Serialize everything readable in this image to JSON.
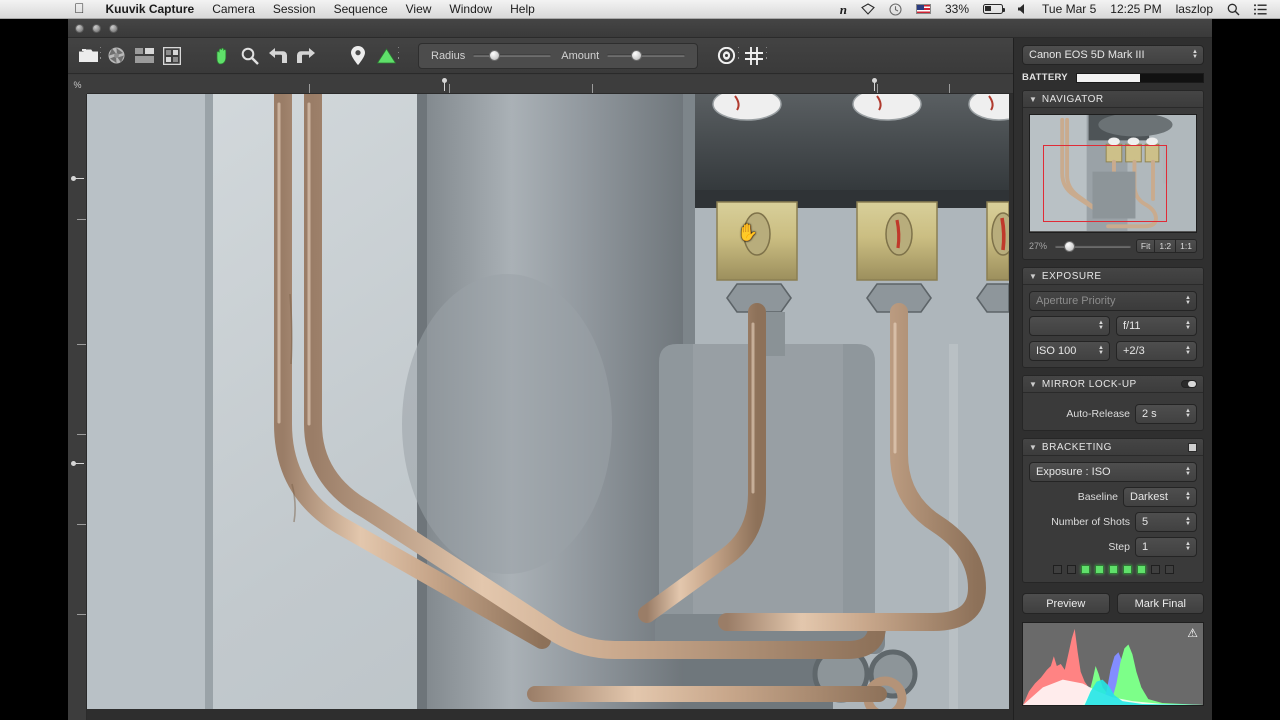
{
  "menubar": {
    "apple_icon": "apple-icon",
    "items": [
      {
        "label": "Kuuvik Capture",
        "bold": true
      },
      {
        "label": "Camera"
      },
      {
        "label": "Session"
      },
      {
        "label": "Sequence"
      },
      {
        "label": "View"
      },
      {
        "label": "Window"
      },
      {
        "label": "Help"
      }
    ],
    "status": {
      "n_icon": "n",
      "shield_icon": "shield-icon",
      "clock_icon": "clock-icon",
      "flag_icon": "us-flag-icon",
      "battery_pct": "33%",
      "battery_icon": "battery-icon",
      "volume_icon": "volume-icon",
      "date": "Tue Mar 5",
      "time": "12:25 PM",
      "user": "laszlop",
      "search_icon": "search-icon",
      "list_icon": "list-icon"
    }
  },
  "toolbar": {
    "buttons": [
      {
        "name": "capture-button",
        "icon": "camera-icon"
      },
      {
        "name": "shutter-button",
        "icon": "aperture-icon"
      },
      {
        "name": "layout-button",
        "icon": "layout-grid-icon"
      },
      {
        "name": "quad-view-button",
        "icon": "quad-grid-icon"
      },
      {
        "name": "hand-tool-button",
        "icon": "hand-icon"
      },
      {
        "name": "zoom-tool-button",
        "icon": "magnifier-icon"
      },
      {
        "name": "rotate-left-button",
        "icon": "rotate-left-icon"
      },
      {
        "name": "rotate-right-button",
        "icon": "rotate-right-icon"
      },
      {
        "name": "pin-button",
        "icon": "location-pin-icon"
      },
      {
        "name": "focus-mask-button",
        "icon": "green-triangle-icon"
      }
    ],
    "radius_label": "Radius",
    "amount_label": "Amount",
    "eye_icon": "eye-target-icon",
    "grid_icon": "grid-hash-icon"
  },
  "ruler": {
    "unit_label": "%"
  },
  "panel": {
    "camera": "Canon EOS 5D Mark III",
    "battery_label": "BATTERY",
    "navigator": {
      "title": "NAVIGATOR",
      "zoom_pct": "27%",
      "fit": "Fit",
      "half": "1:2",
      "one_to_one": "1:1"
    },
    "exposure": {
      "title": "EXPOSURE",
      "mode": "Aperture Priority",
      "shutter": "",
      "aperture": "f/11",
      "iso": "ISO 100",
      "compensation": "+2/3"
    },
    "mirror_lockup": {
      "title": "MIRROR LOCK-UP",
      "auto_release_label": "Auto-Release",
      "auto_release_value": "2 s",
      "enabled": true
    },
    "bracketing": {
      "title": "BRACKETING",
      "mode": "Exposure : ISO",
      "baseline_label": "Baseline",
      "baseline_value": "Darkest",
      "shots_label": "Number of Shots",
      "shots_value": "5",
      "step_label": "Step",
      "step_value": "1",
      "leds": [
        false,
        false,
        true,
        true,
        true,
        true,
        true,
        false,
        false
      ]
    },
    "preview_button": "Preview",
    "mark_final_button": "Mark Final",
    "histogram_warning_icon": "warning-triangle-icon"
  },
  "colors": {
    "accent_green": "#5fe06a",
    "nav_rect": "#e02b36",
    "panel_bg": "#2f2f2f",
    "toolbar_bg": "#3e3e3e"
  }
}
